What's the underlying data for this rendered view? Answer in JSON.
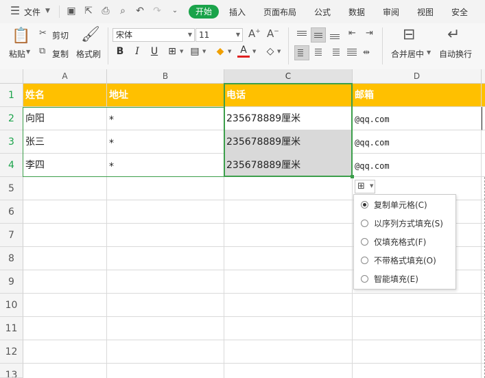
{
  "menubar": {
    "file_label": "文件",
    "tabs": [
      "开始",
      "插入",
      "页面布局",
      "公式",
      "数据",
      "审阅",
      "视图",
      "安全"
    ]
  },
  "ribbon": {
    "paste": "粘贴",
    "cut": "剪切",
    "copy": "复制",
    "format_painter": "格式刷",
    "font_name": "宋体",
    "font_size": "11",
    "bold": "B",
    "italic": "I",
    "underline": "U",
    "merge_center": "合并居中",
    "wrap_text": "自动换行"
  },
  "sheet": {
    "columns": [
      "A",
      "B",
      "C",
      "D"
    ],
    "rows": [
      "1",
      "2",
      "3",
      "4",
      "5",
      "6",
      "7",
      "8",
      "9",
      "10",
      "11",
      "12",
      "13"
    ],
    "header": [
      "姓名",
      "地址",
      "电话",
      "邮箱"
    ],
    "data": [
      [
        "向阳",
        "*",
        "235678889厘米",
        "@qq.com"
      ],
      [
        "张三",
        "*",
        "235678889厘米",
        "@qq.com"
      ],
      [
        "李四",
        "*",
        "235678889厘米",
        "@qq.com"
      ]
    ]
  },
  "autofill_menu": {
    "options": [
      "复制单元格(C)",
      "以序列方式填充(S)",
      "仅填充格式(F)",
      "不带格式填充(O)",
      "智能填充(E)"
    ],
    "selected_index": 0
  },
  "colors": {
    "accent": "#1aa34a",
    "header_fill": "#ffc000",
    "selection_border": "#3b9e4a"
  }
}
